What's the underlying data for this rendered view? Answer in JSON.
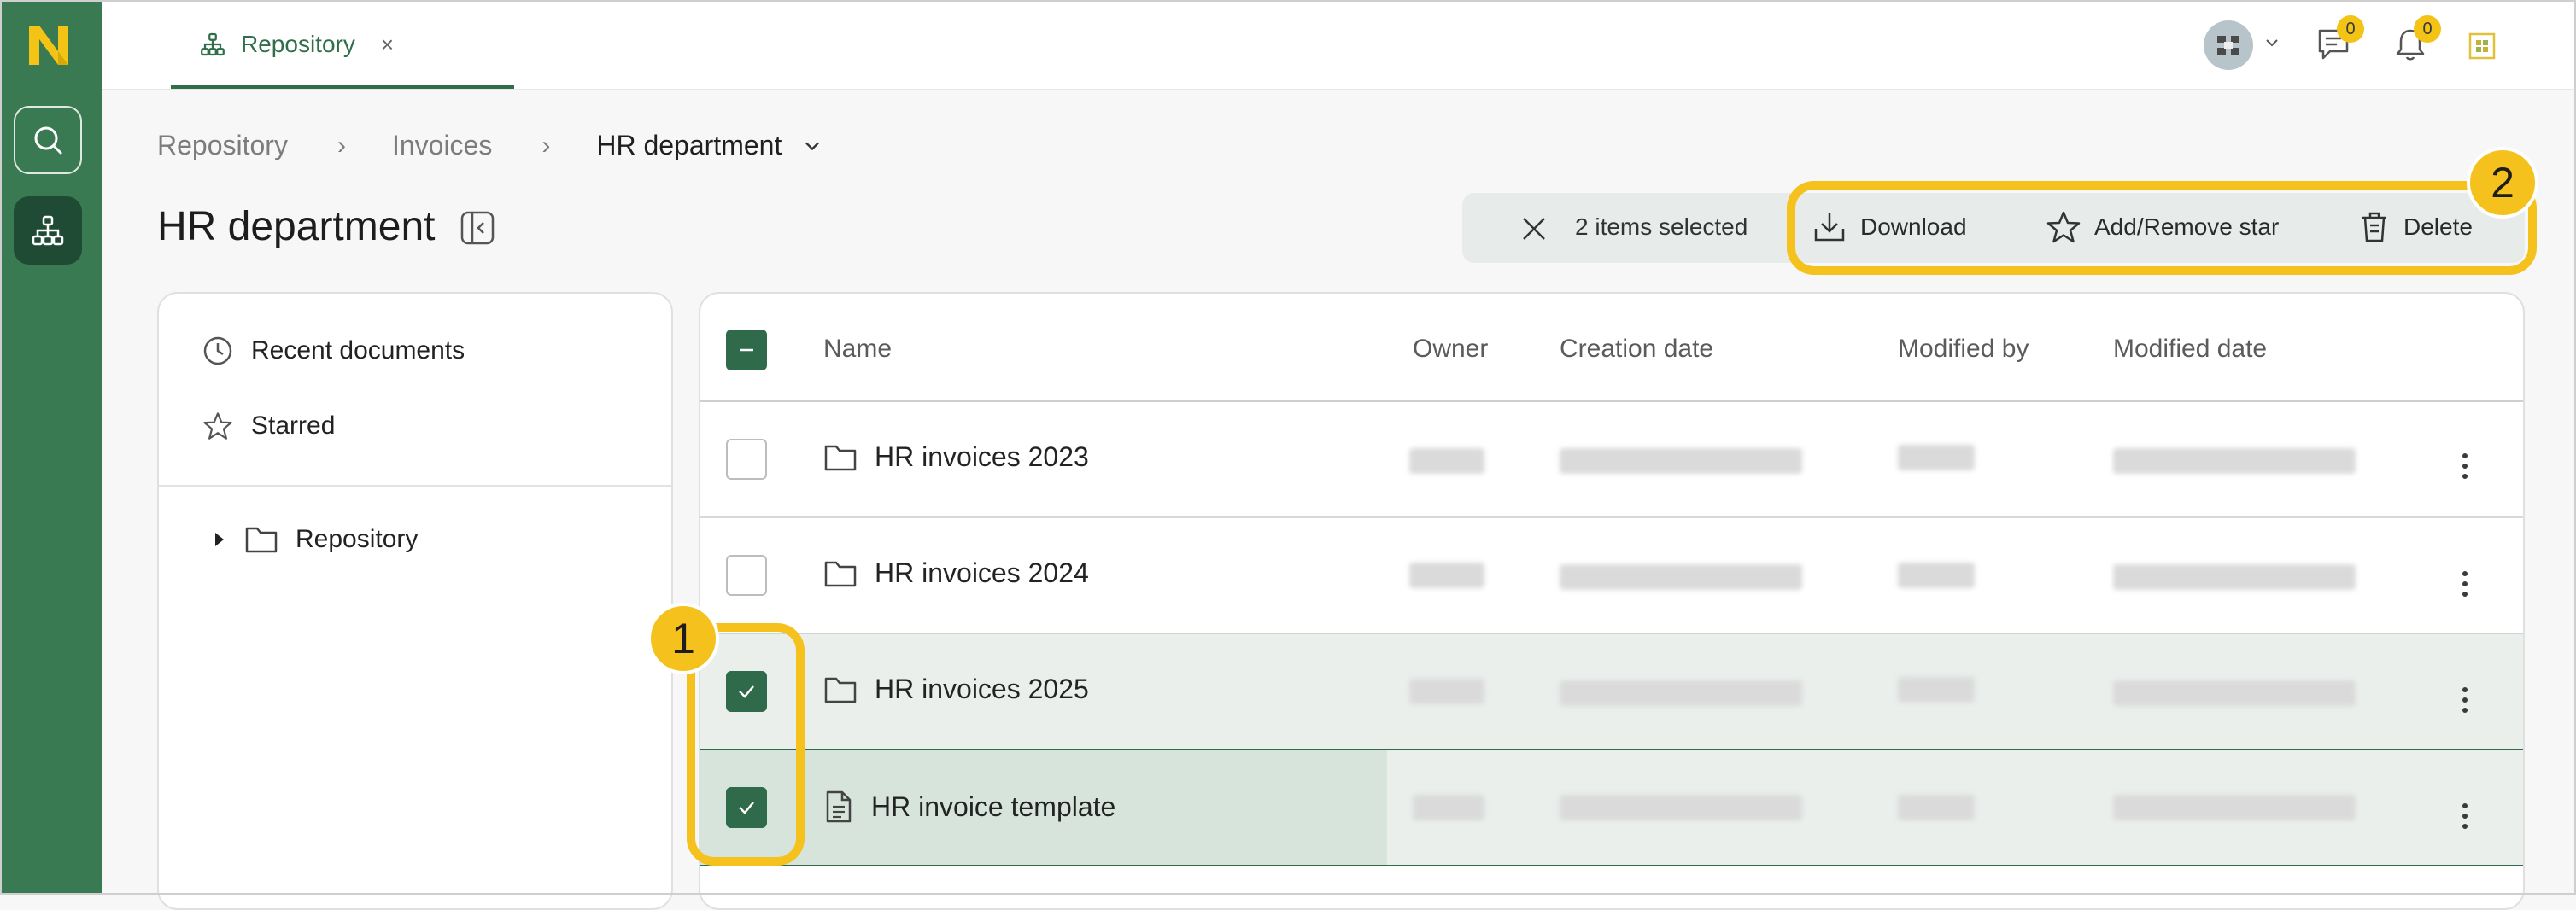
{
  "app": {
    "tab_label": "Repository",
    "tab_close": "×"
  },
  "topbar": {
    "messages_count": "0",
    "notifications_count": "0"
  },
  "breadcrumb": {
    "items": [
      "Repository",
      "Invoices"
    ],
    "current": "HR department",
    "separator": "›"
  },
  "page": {
    "title": "HR department"
  },
  "selection_bar": {
    "count_label": "2 items selected",
    "download_label": "Download",
    "star_label": "Add/Remove star",
    "delete_label": "Delete"
  },
  "callouts": {
    "first": "1",
    "second": "2"
  },
  "sidebar": {
    "recent_label": "Recent documents",
    "starred_label": "Starred",
    "tree_root_label": "Repository"
  },
  "table": {
    "columns": {
      "name": "Name",
      "owner": "Owner",
      "creation_date": "Creation date",
      "modified_by": "Modified by",
      "modified_date": "Modified date"
    },
    "rows": [
      {
        "name": "HR invoices 2023",
        "type": "folder",
        "selected": false
      },
      {
        "name": "HR invoices 2024",
        "type": "folder",
        "selected": false
      },
      {
        "name": "HR invoices 2025",
        "type": "folder",
        "selected": true
      },
      {
        "name": "HR invoice template",
        "type": "document",
        "selected": true
      }
    ]
  },
  "colors": {
    "brand_green": "#3a7a52",
    "dark_green": "#2f6a4a",
    "callout_yellow": "#f5c21d",
    "logo_yellow": "#f3c315"
  }
}
